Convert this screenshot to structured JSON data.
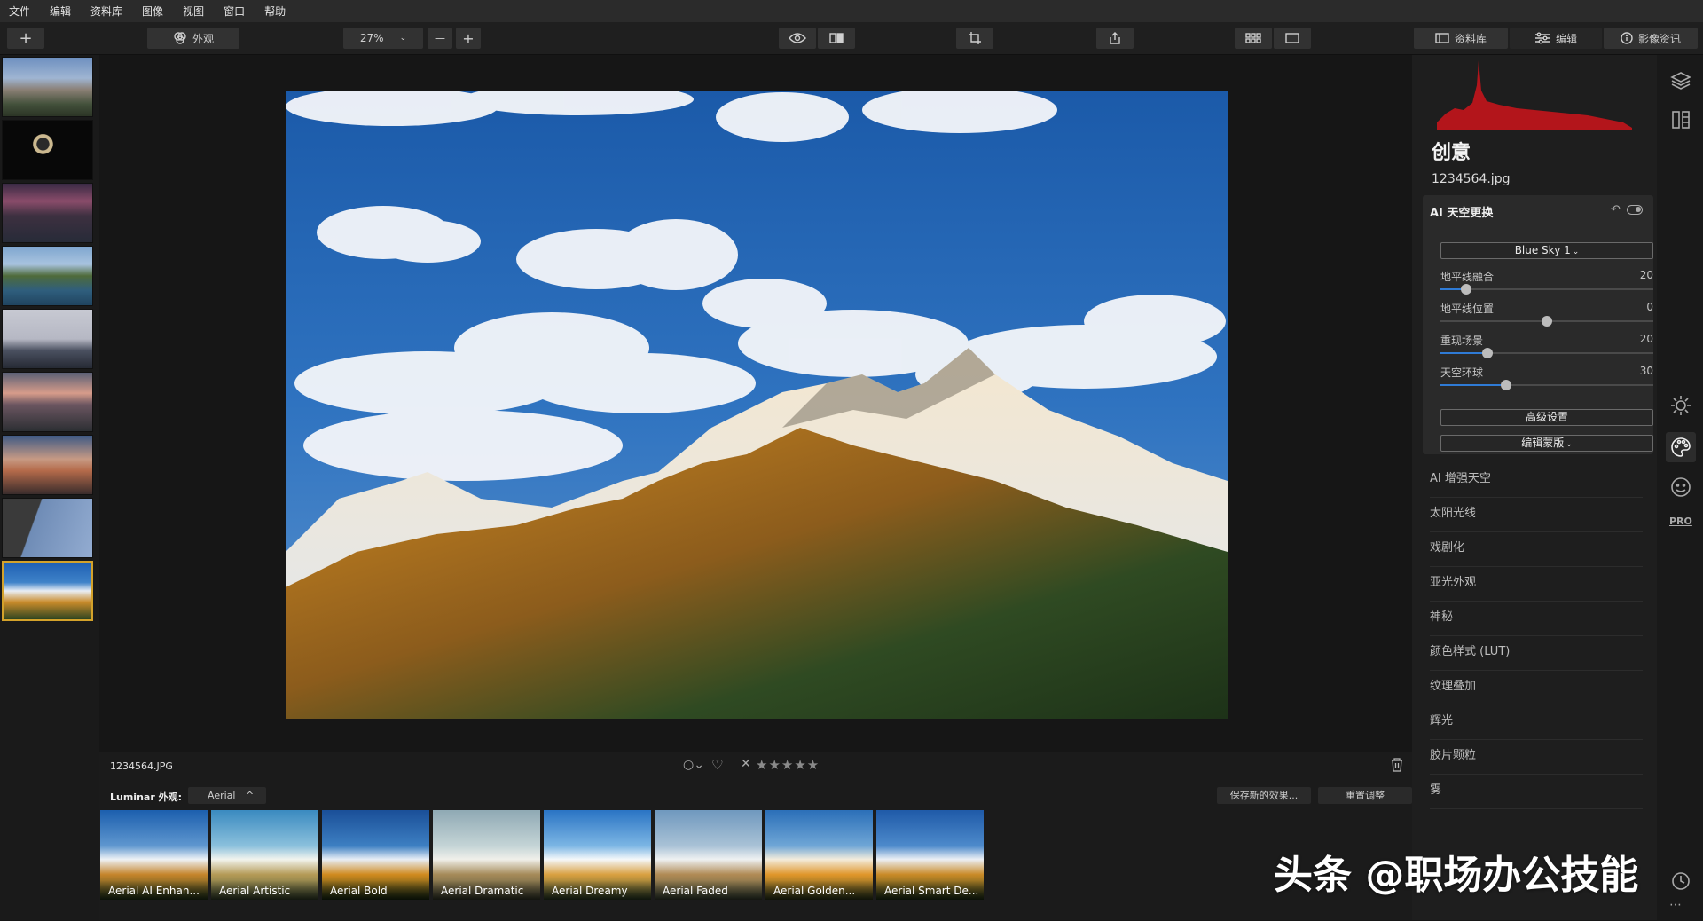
{
  "menu": [
    "文件",
    "编辑",
    "资料库",
    "图像",
    "视图",
    "窗口",
    "帮助"
  ],
  "toolbar": {
    "add_label": "+",
    "looks_label": "外观",
    "zoom_value": "27%",
    "zoom_out": "—",
    "zoom_in": "+",
    "library_label": "资料库",
    "edit_label": "编辑",
    "info_label": "影像资讯"
  },
  "panel": {
    "title": "创意",
    "filename": "1234564.jpg",
    "tool_title": "AI 天空更换",
    "sky_select": "Blue Sky 1",
    "sliders": [
      {
        "label": "地平线融合",
        "value": 20,
        "fraction": 0.12
      },
      {
        "label": "地平线位置",
        "value": 0,
        "fraction": 0.5
      },
      {
        "label": "重现场景",
        "value": 20,
        "fraction": 0.22
      },
      {
        "label": "天空环球",
        "value": 30,
        "fraction": 0.31
      }
    ],
    "advanced_button": "高级设置",
    "mask_button": "编辑蒙版",
    "tools": [
      "AI 增强天空",
      "太阳光线",
      "戏剧化",
      "亚光外观",
      "神秘",
      "颜色样式 (LUT)",
      "纹理叠加",
      "辉光",
      "胶片颗粒",
      "雾"
    ],
    "side_pro": "PRO"
  },
  "info": {
    "filename": "1234564.JPG",
    "rating_stars": "★★★★★"
  },
  "presetbar": {
    "label": "Luminar 外观:",
    "category": "Aerial",
    "save_button": "保存新的效果...",
    "reset_button": "重置调整"
  },
  "presets": [
    "Aerial AI Enhan...",
    "Aerial Artistic",
    "Aerial Bold",
    "Aerial Dramatic",
    "Aerial Dreamy",
    "Aerial Faded",
    "Aerial Golden...",
    "Aerial Smart De..."
  ],
  "watermark": "头条 @职场办公技能",
  "colors": {
    "accent": "#2f7bd6",
    "selection": "#d4a22a",
    "histogram": "#b3151b"
  }
}
